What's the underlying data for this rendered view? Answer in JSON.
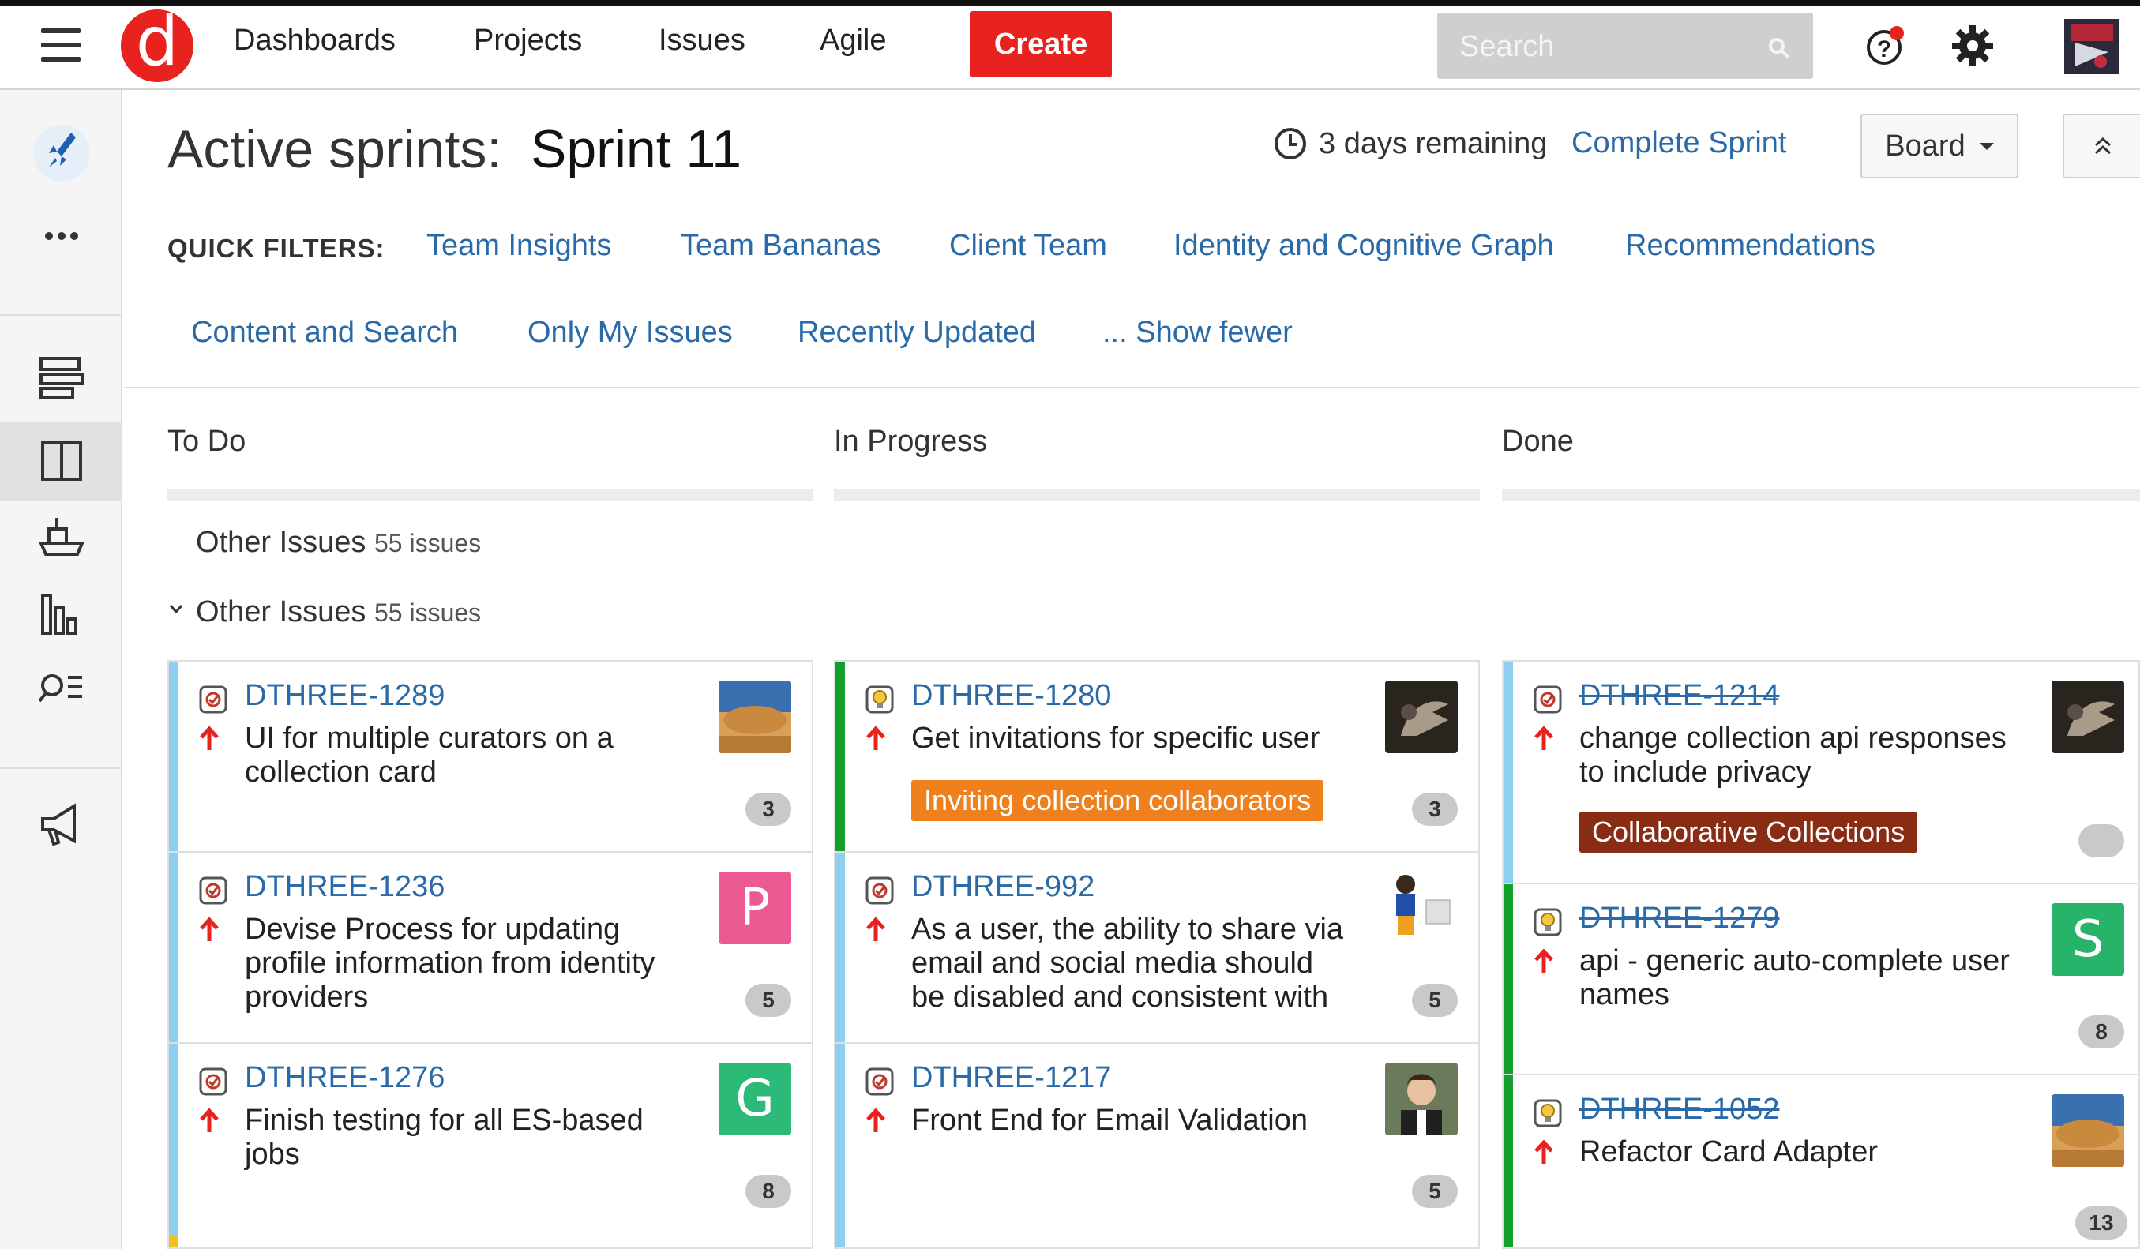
{
  "nav": {
    "items": [
      "Dashboards",
      "Projects",
      "Issues",
      "Agile"
    ],
    "create_label": "Create",
    "search_placeholder": "Search",
    "logo_letter": "d"
  },
  "page": {
    "title_prefix": "Active sprints:",
    "sprint_name": "Sprint 11",
    "remaining": "3 days remaining",
    "complete_label": "Complete Sprint",
    "board_label": "Board"
  },
  "quick_filters": {
    "label": "QUICK FILTERS:",
    "items": [
      "Team Insights",
      "Team Bananas",
      "Client Team",
      "Identity and Cognitive Graph",
      "Recommendations",
      "Content and Search",
      "Only My Issues",
      "Recently Updated",
      "... Show fewer"
    ]
  },
  "columns": [
    "To Do",
    "In Progress",
    "Done"
  ],
  "swimlanes": [
    {
      "name": "Other Issues",
      "count": "55 issues"
    },
    {
      "name": "Other Issues",
      "count": "55 issues"
    }
  ],
  "cards": {
    "todo": [
      {
        "key": "DTHREE-1289",
        "summary": [
          "UI for multiple curators on a",
          "collection card"
        ],
        "estimate": "3"
      },
      {
        "key": "DTHREE-1236",
        "summary": [
          "Devise Process for updating",
          "profile information from identity",
          "providers"
        ],
        "estimate": "5",
        "avatar_letter": "P"
      },
      {
        "key": "DTHREE-1276",
        "summary": [
          "Finish testing for all ES-based",
          "jobs"
        ],
        "estimate": "8",
        "avatar_letter": "G"
      }
    ],
    "inprogress": [
      {
        "key": "DTHREE-1280",
        "summary": [
          "Get invitations for specific user"
        ],
        "epic": "Inviting collection collaborators",
        "estimate": "3"
      },
      {
        "key": "DTHREE-992",
        "summary": [
          "As a user, the ability to share via",
          "email and social media should",
          "be disabled and consistent with"
        ],
        "estimate": "5"
      },
      {
        "key": "DTHREE-1217",
        "summary": [
          "Front End for Email Validation"
        ],
        "estimate": "5"
      }
    ],
    "done": [
      {
        "key": "DTHREE-1214",
        "summary": [
          "change collection api responses",
          "to include privacy"
        ],
        "epic": "Collaborative Collections",
        "estimate": ""
      },
      {
        "key": "DTHREE-1279",
        "summary": [
          "api - generic auto-complete user",
          "names"
        ],
        "estimate": "8",
        "avatar_letter": "S"
      },
      {
        "key": "DTHREE-1052",
        "summary": [
          "Refactor Card Adapter"
        ],
        "estimate": "13"
      }
    ]
  },
  "colors": {
    "brand_red": "#e8231f",
    "link_blue": "#2a6aa8",
    "flag_blue": "#8ecff0",
    "flag_green": "#14a02c",
    "epic_orange": "#f0801c",
    "epic_brown": "#8a2c14",
    "avatar_pink": "#ec5a92",
    "avatar_green": "#2bba78",
    "avatar_green2": "#27b36a"
  },
  "icons": [
    "menu-icon",
    "search-icon",
    "help-icon",
    "gear-icon",
    "rocket-icon",
    "more-icon",
    "backlog-icon",
    "board-icon",
    "releases-icon",
    "reports-icon",
    "issues-search-icon",
    "announce-icon",
    "clock-icon",
    "priority-up-icon",
    "story-icon",
    "improvement-icon"
  ]
}
